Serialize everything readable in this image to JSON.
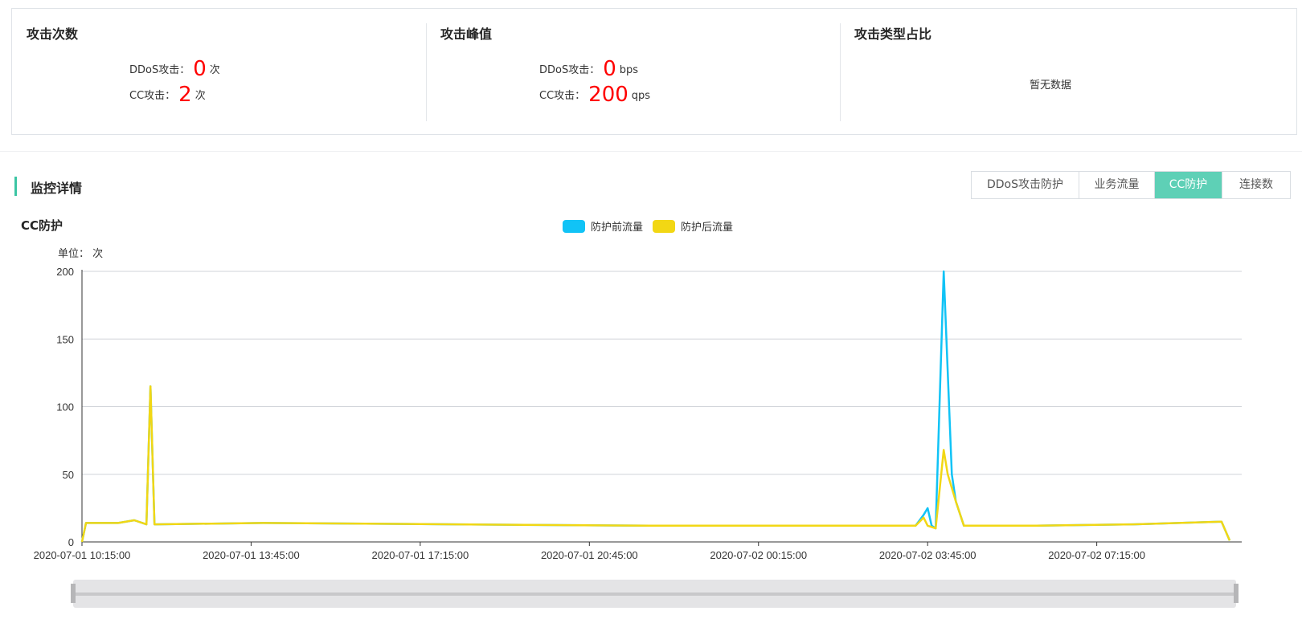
{
  "stats": {
    "attack_count": {
      "title": "攻击次数",
      "ddos_label": "DDoS攻击：",
      "ddos_value": "0",
      "ddos_unit": "次",
      "cc_label": "CC攻击：",
      "cc_value": "2",
      "cc_unit": "次"
    },
    "attack_peak": {
      "title": "攻击峰值",
      "ddos_label": "DDoS攻击：",
      "ddos_value": "0",
      "ddos_unit": "bps",
      "cc_label": "CC攻击：",
      "cc_value": "200",
      "cc_unit": "qps"
    },
    "attack_type": {
      "title": "攻击类型占比",
      "empty_text": "暂无数据"
    }
  },
  "section": {
    "title": "监控详情"
  },
  "tabs": [
    {
      "label": "DDoS攻击防护",
      "active": false
    },
    {
      "label": "业务流量",
      "active": false
    },
    {
      "label": "CC防护",
      "active": true
    },
    {
      "label": "连接数",
      "active": false
    }
  ],
  "colors": {
    "accent": "#5ed0b6",
    "before": "#11c3f6",
    "after": "#f2d714",
    "danger": "#ff0000"
  },
  "chart_data": {
    "type": "line",
    "title": "CC防护",
    "unit_label": "单位： 次",
    "ylim": [
      0,
      200
    ],
    "yticks": [
      0,
      50,
      100,
      150,
      200
    ],
    "x_tick_labels": [
      "2020-07-01 10:15:00",
      "2020-07-01 13:45:00",
      "2020-07-01 17:15:00",
      "2020-07-01 20:45:00",
      "2020-07-02 00:15:00",
      "2020-07-02 03:45:00",
      "2020-07-02 07:15:00"
    ],
    "x_range": [
      "2020-07-01 10:15:00",
      "2020-07-02 10:15:00"
    ],
    "series": [
      {
        "name": "防护前流量",
        "color": "#11c3f6",
        "points": [
          [
            "2020-07-01 10:15:00",
            0
          ],
          [
            "2020-07-01 10:20:00",
            14
          ],
          [
            "2020-07-01 11:00:00",
            14
          ],
          [
            "2020-07-01 11:20:00",
            16
          ],
          [
            "2020-07-01 11:35:00",
            13
          ],
          [
            "2020-07-01 11:40:00",
            115
          ],
          [
            "2020-07-01 11:45:00",
            13
          ],
          [
            "2020-07-01 14:00:00",
            14
          ],
          [
            "2020-07-01 18:00:00",
            13
          ],
          [
            "2020-07-01 22:00:00",
            12
          ],
          [
            "2020-07-02 02:00:00",
            12
          ],
          [
            "2020-07-02 03:30:00",
            12
          ],
          [
            "2020-07-02 03:40:00",
            20
          ],
          [
            "2020-07-02 03:45:00",
            25
          ],
          [
            "2020-07-02 03:50:00",
            12
          ],
          [
            "2020-07-02 03:55:00",
            10
          ],
          [
            "2020-07-02 04:05:00",
            200
          ],
          [
            "2020-07-02 04:15:00",
            50
          ],
          [
            "2020-07-02 04:20:00",
            30
          ],
          [
            "2020-07-02 04:30:00",
            12
          ],
          [
            "2020-07-02 06:00:00",
            12
          ],
          [
            "2020-07-02 08:00:00",
            13
          ],
          [
            "2020-07-02 09:50:00",
            15
          ],
          [
            "2020-07-02 10:00:00",
            1
          ]
        ]
      },
      {
        "name": "防护后流量",
        "color": "#f2d714",
        "points": [
          [
            "2020-07-01 10:15:00",
            0
          ],
          [
            "2020-07-01 10:20:00",
            14
          ],
          [
            "2020-07-01 11:00:00",
            14
          ],
          [
            "2020-07-01 11:20:00",
            16
          ],
          [
            "2020-07-01 11:35:00",
            13
          ],
          [
            "2020-07-01 11:40:00",
            115
          ],
          [
            "2020-07-01 11:45:00",
            13
          ],
          [
            "2020-07-01 14:00:00",
            14
          ],
          [
            "2020-07-01 18:00:00",
            13
          ],
          [
            "2020-07-01 22:00:00",
            12
          ],
          [
            "2020-07-02 02:00:00",
            12
          ],
          [
            "2020-07-02 03:30:00",
            12
          ],
          [
            "2020-07-02 03:40:00",
            18
          ],
          [
            "2020-07-02 03:45:00",
            12
          ],
          [
            "2020-07-02 03:55:00",
            10
          ],
          [
            "2020-07-02 04:05:00",
            68
          ],
          [
            "2020-07-02 04:10:00",
            50
          ],
          [
            "2020-07-02 04:20:00",
            30
          ],
          [
            "2020-07-02 04:30:00",
            12
          ],
          [
            "2020-07-02 06:00:00",
            12
          ],
          [
            "2020-07-02 08:00:00",
            13
          ],
          [
            "2020-07-02 09:50:00",
            15
          ],
          [
            "2020-07-02 10:00:00",
            1
          ]
        ]
      }
    ],
    "grid": true,
    "legend_position": "top-center"
  },
  "data_zoom": {
    "start": 0,
    "end": 1
  }
}
